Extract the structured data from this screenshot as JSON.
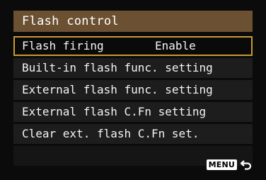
{
  "title": "Flash control",
  "menu": {
    "items": [
      {
        "label": "Flash firing",
        "value": "Enable"
      },
      {
        "label": "Built-in flash func. setting"
      },
      {
        "label": "External flash func. setting"
      },
      {
        "label": "External flash C.Fn setting"
      },
      {
        "label": "Clear ext. flash C.Fn set."
      }
    ]
  },
  "footer": {
    "menu_button_label": "MENU",
    "return_icon": "return-arrow-icon"
  },
  "colors": {
    "title_bar": "#6b5132",
    "selection_border": "#c79a2e",
    "row_background": "#1d1d1d"
  }
}
